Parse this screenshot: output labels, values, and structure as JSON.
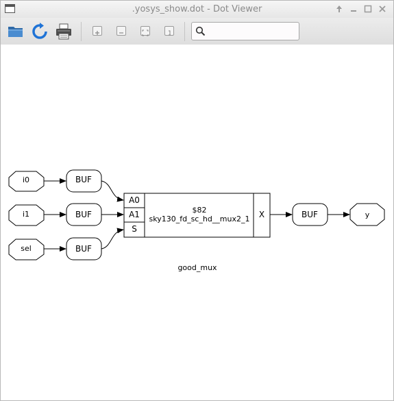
{
  "window": {
    "title": ".yosys_show.dot - Dot Viewer",
    "controls": [
      "restore-up",
      "minimize",
      "maximize",
      "close"
    ]
  },
  "toolbar": {
    "buttons": [
      "open-folder-icon",
      "reload-icon",
      "print-icon",
      "zoom-in-icon",
      "zoom-out-icon",
      "zoom-fit-icon",
      "zoom-100-icon"
    ],
    "search": {
      "value": "",
      "placeholder": ""
    }
  },
  "graph": {
    "label": "good_mux",
    "inputs": [
      "i0",
      "i1",
      "sel"
    ],
    "output": "y",
    "buffers": [
      "BUF",
      "BUF",
      "BUF",
      "BUF"
    ],
    "cell": {
      "id": "$82",
      "type": "sky130_fd_sc_hd__mux2_1",
      "in_ports": [
        "A0",
        "A1",
        "S"
      ],
      "out_port": "X"
    }
  }
}
